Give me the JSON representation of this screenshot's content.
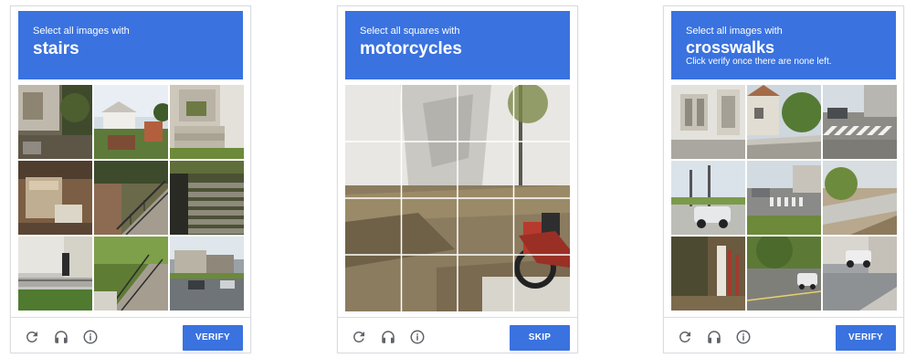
{
  "captchas": [
    {
      "instruction": "Select all images with",
      "target": "stairs",
      "note": "",
      "button": "VERIFY"
    },
    {
      "instruction": "Select all squares with",
      "target": "motorcycles",
      "note": "",
      "button": "SKIP"
    },
    {
      "instruction": "Select all images with",
      "target": "crosswalks",
      "note": "Click verify once there are none left.",
      "button": "VERIFY"
    }
  ],
  "icons": {
    "reload": "reload-icon",
    "audio": "headphones-icon",
    "info": "info-icon"
  },
  "colors": {
    "accent": "#3a72df",
    "border": "#dadce0",
    "icon": "#5f6368"
  }
}
